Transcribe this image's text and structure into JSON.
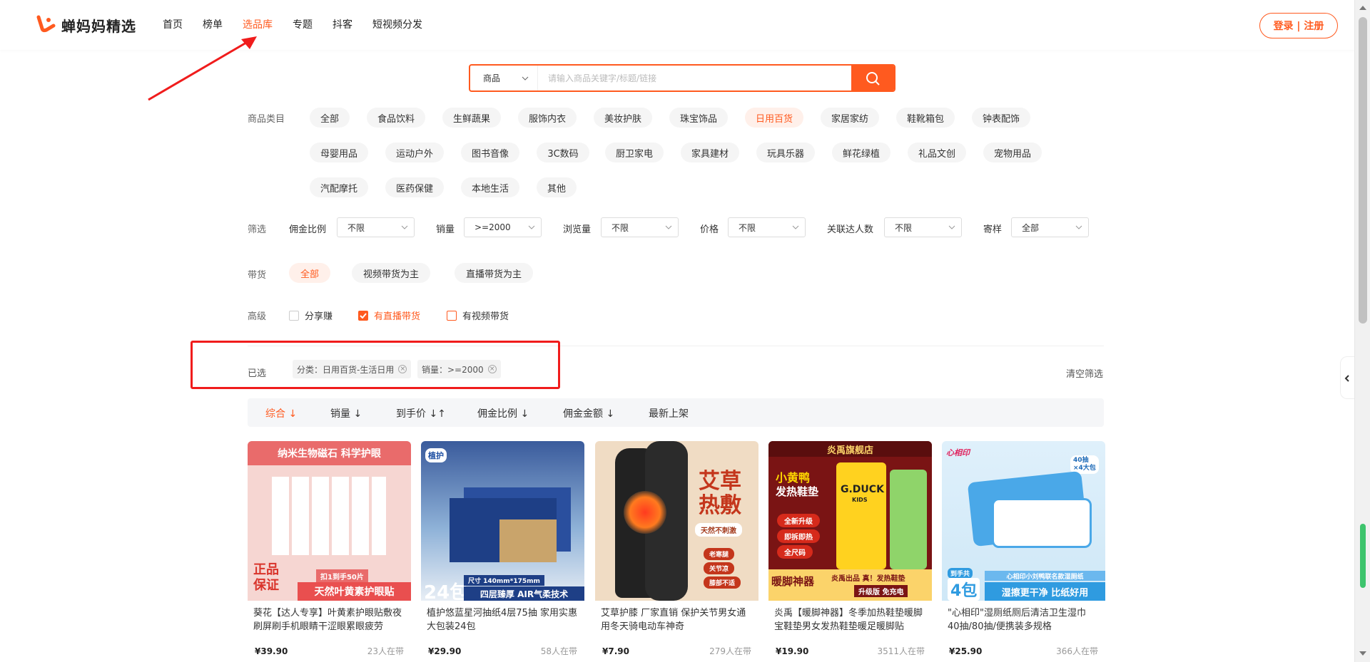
{
  "brand": {
    "name": "蝉妈妈精选",
    "accent": "#ff5a1f"
  },
  "nav": [
    "首页",
    "榜单",
    "选品库",
    "专题",
    "抖客",
    "短视频分发"
  ],
  "nav_active": "选品库",
  "login": "登录 | 注册",
  "search": {
    "category": "商品",
    "placeholder": "请输入商品关键字/标题/链接"
  },
  "category_label": "商品类目",
  "categories_row1": [
    "全部",
    "食品饮料",
    "生鲜蔬果",
    "服饰内衣",
    "美妆护肤",
    "珠宝饰品",
    "日用百货",
    "家居家纺",
    "鞋靴箱包",
    "钟表配饰"
  ],
  "categories_row2": [
    "母婴用品",
    "运动户外",
    "图书音像",
    "3C数码",
    "厨卫家电",
    "家具建材",
    "玩具乐器",
    "鲜花绿植",
    "礼品文创",
    "宠物用品"
  ],
  "categories_row3": [
    "汽配摩托",
    "医药保健",
    "本地生活",
    "其他"
  ],
  "category_active": "日用百货",
  "filter": {
    "label": "筛选",
    "items": [
      {
        "label": "佣金比例",
        "value": "不限"
      },
      {
        "label": "销量",
        "value": ">=2000"
      },
      {
        "label": "浏览量",
        "value": "不限"
      },
      {
        "label": "价格",
        "value": "不限"
      },
      {
        "label": "关联达人数",
        "value": "不限"
      },
      {
        "label": "寄样",
        "value": "全部"
      }
    ]
  },
  "delivery": {
    "label": "带货",
    "options": [
      "全部",
      "视频带货为主",
      "直播带货为主"
    ],
    "active": "全部"
  },
  "advanced": {
    "label": "高级",
    "options": [
      {
        "label": "分享赚",
        "checked": false
      },
      {
        "label": "有直播带货",
        "checked": true
      },
      {
        "label": "有视频带货",
        "checked": false
      }
    ]
  },
  "selected": {
    "label": "已选",
    "tags": [
      "分类：日用百货-生活日用",
      "销量：>=2000"
    ],
    "clear": "清空筛选"
  },
  "sort": [
    "综合",
    "销量",
    "到手价",
    "佣金比例",
    "佣金金额",
    "最新上架"
  ],
  "sort_active": "综合",
  "products": [
    {
      "title": "葵花【达人专享】叶黄素护眼贴敷夜刷屏刷手机眼睛干涩眼累眼疲劳",
      "price": "¥39.90",
      "sellers": "23人在带",
      "img_texts": [
        "纳米生物磁石 科学护眼",
        "正品",
        "保证",
        "扣1到手50片",
        "天然叶黄素护眼贴"
      ]
    },
    {
      "title": "植护悠蓝星河抽纸4层75抽 家用实惠大包装24包",
      "price": "¥29.90",
      "sellers": "58人在带",
      "img_texts": [
        "植护",
        "24包",
        "尺寸 140mm*175mm",
        "四层臻厚 AIR气柔技术"
      ]
    },
    {
      "title": "艾草护膝 厂家直销 保护关节男女通用冬天骑电动车神奇",
      "price": "¥7.90",
      "sellers": "279人在带",
      "img_texts": [
        "艾草",
        "热敷",
        "天然不刺激",
        "老寒腿",
        "关节凉",
        "膝部不适"
      ]
    },
    {
      "title": "炎禹【暖脚神器】冬季加热鞋垫暖脚宝鞋垫男女发热鞋垫暖足暖脚贴",
      "price": "¥19.90",
      "sellers": "3511人在带",
      "img_texts": [
        "炎禹旗舰店",
        "小黄鸭",
        "发热鞋垫",
        "全新升级",
        "即拆即热",
        "全尺码",
        "暖脚神器",
        "炎禹出品 真！发热鞋垫",
        "升级版 免充电",
        "G.DUCK",
        "KIDS"
      ]
    },
    {
      "title": "\"心相印\"湿厕纸厕后清洁卫生湿巾 40抽/80抽/便携装多规格",
      "price": "¥25.90",
      "sellers": "366人在带",
      "img_texts": [
        "心相印",
        "40抽",
        "×4大包",
        "到手共",
        "4包",
        "心相印小刘鸭联名款湿厕纸",
        "湿擦更干净 比纸好用"
      ]
    }
  ]
}
